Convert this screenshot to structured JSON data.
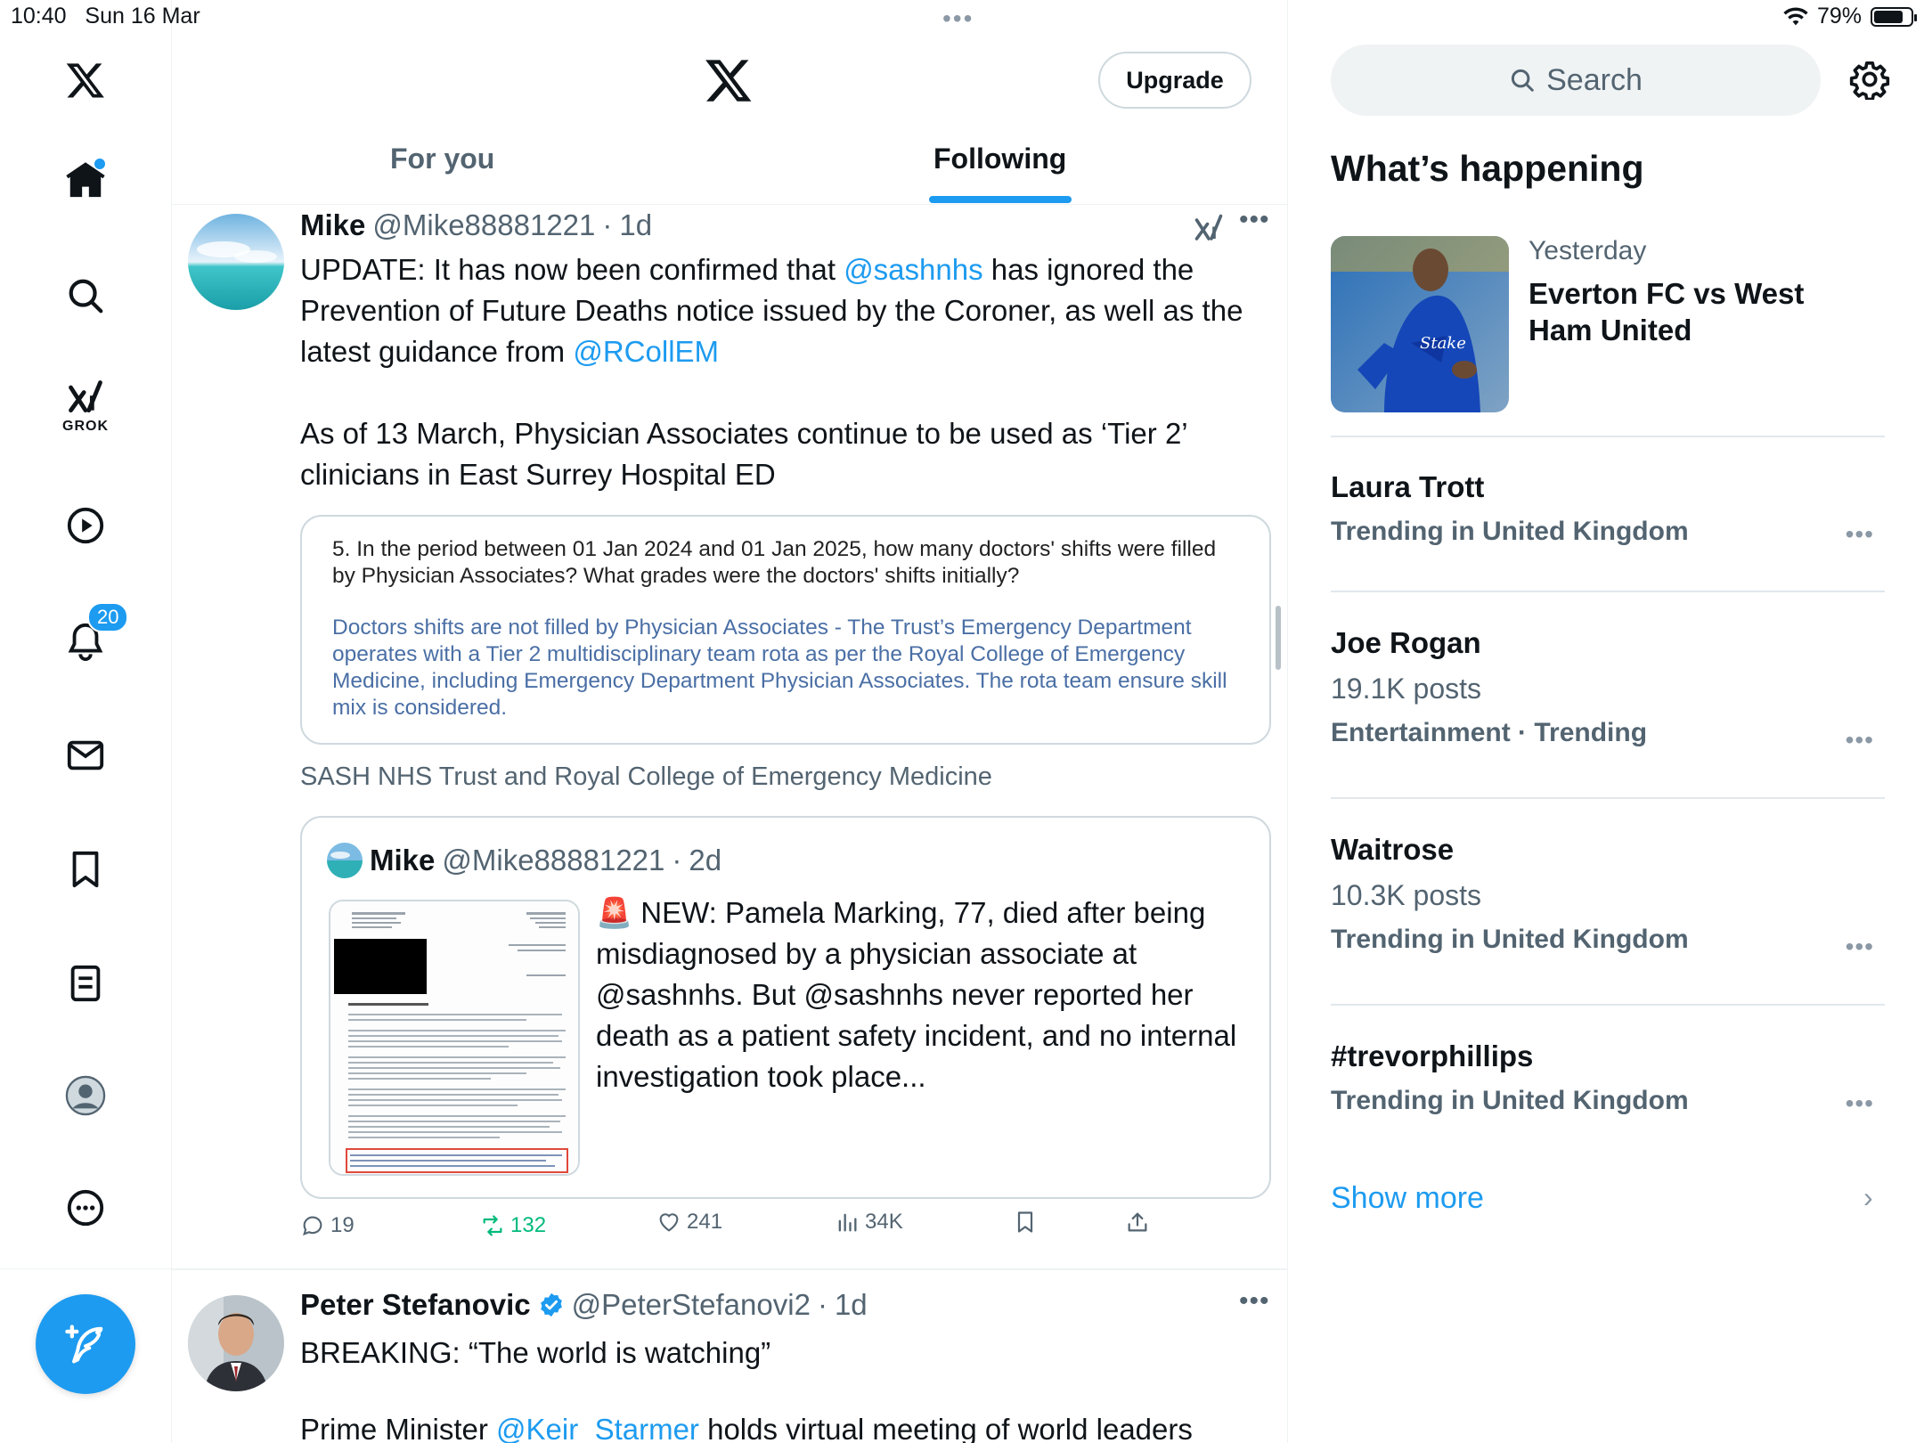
{
  "status_bar": {
    "time": "10:40",
    "date": "Sun 16 Mar",
    "battery": "79%",
    "battery_level": 0.79
  },
  "nav": {
    "notifications_badge": "20",
    "grok_label": "GROK"
  },
  "header": {
    "upgrade_label": "Upgrade",
    "tabs": [
      {
        "label": "For you",
        "active": false
      },
      {
        "label": "Following",
        "active": true
      }
    ]
  },
  "tweets": [
    {
      "name": "Mike",
      "handle": "@Mike88881221",
      "sep": "·",
      "time": "1d",
      "text_parts": {
        "p1_a": "UPDATE: It has now been confirmed that ",
        "p1_m1": "@sashnhs",
        "p1_b": " has ignored the Prevention of Future Deaths notice issued by the Coroner, as well as the latest guidance from ",
        "p1_m2": "@RCollEM",
        "p2": "As of 13 March, Physician Associates continue to be used as ‘Tier 2’ clinicians in East Surrey Hospital ED"
      },
      "image_card": {
        "question": "5. In the period between 01 Jan 2024 and 01 Jan 2025, how many doctors' shifts were filled by Physician Associates? What grades were the doctors' shifts initially?",
        "answer": "Doctors shifts are not filled by Physician Associates -  The Trust’s Emergency Department operates with a Tier 2 multidisciplinary team rota as per the Royal College of Emergency Medicine, including Emergency Department Physician Associates. The rota team ensure skill mix is considered."
      },
      "caption": "SASH NHS Trust and Royal College of Emergency Medicine",
      "quoted": {
        "name": "Mike",
        "handle": "@Mike88881221",
        "sep": "·",
        "time": "2d",
        "emoji": "🚨",
        "text": " NEW: Pamela Marking, 77, died after being misdiagnosed by a physician associate at @sashnhs. But @sashnhs never reported her death as a patient safety incident, and no internal investigation took place..."
      },
      "actions": {
        "replies": "19",
        "reposts": "132",
        "likes": "241",
        "views": "34K"
      }
    },
    {
      "name": "Peter Stefanovic",
      "verified": true,
      "handle": "@PeterStefanovi2",
      "sep": "·",
      "time": "1d",
      "text": "BREAKING: “The world is watching”",
      "text2_a": "Prime Minister ",
      "text2_m": "@Keir_Starmer",
      "text2_b": " holds virtual meeting of world leaders"
    }
  ],
  "sidebar": {
    "search_placeholder": "Search",
    "whats_happening": "What’s happening",
    "news": {
      "meta": "Yesterday",
      "title": "Everton FC vs West Ham United"
    },
    "trends": [
      {
        "title": "Laura Trott",
        "posts": "",
        "context": "Trending in United Kingdom"
      },
      {
        "title": "Joe Rogan",
        "posts": "19.1K posts",
        "context": "Entertainment · Trending"
      },
      {
        "title": "Waitrose",
        "posts": "10.3K posts",
        "context": "Trending in United Kingdom"
      },
      {
        "title": "#trevorphillips",
        "posts": "",
        "context": "Trending in United Kingdom"
      }
    ],
    "show_more": "Show more"
  },
  "colors": {
    "accent": "#1d9bf0",
    "repost_green": "#00ba7c",
    "text_primary": "#0f1419",
    "text_secondary": "#536471"
  },
  "icons": [
    "x-logo-icon",
    "home-icon",
    "search-icon",
    "grok-icon",
    "video-icon",
    "bell-icon",
    "mail-icon",
    "bookmark-icon",
    "lists-icon",
    "profile-icon",
    "more-icon",
    "compose-icon",
    "gear-icon",
    "reply-icon",
    "repost-icon",
    "like-icon",
    "views-icon",
    "share-icon",
    "verified-icon",
    "chevron-right-icon",
    "wifi-icon",
    "battery-icon"
  ]
}
